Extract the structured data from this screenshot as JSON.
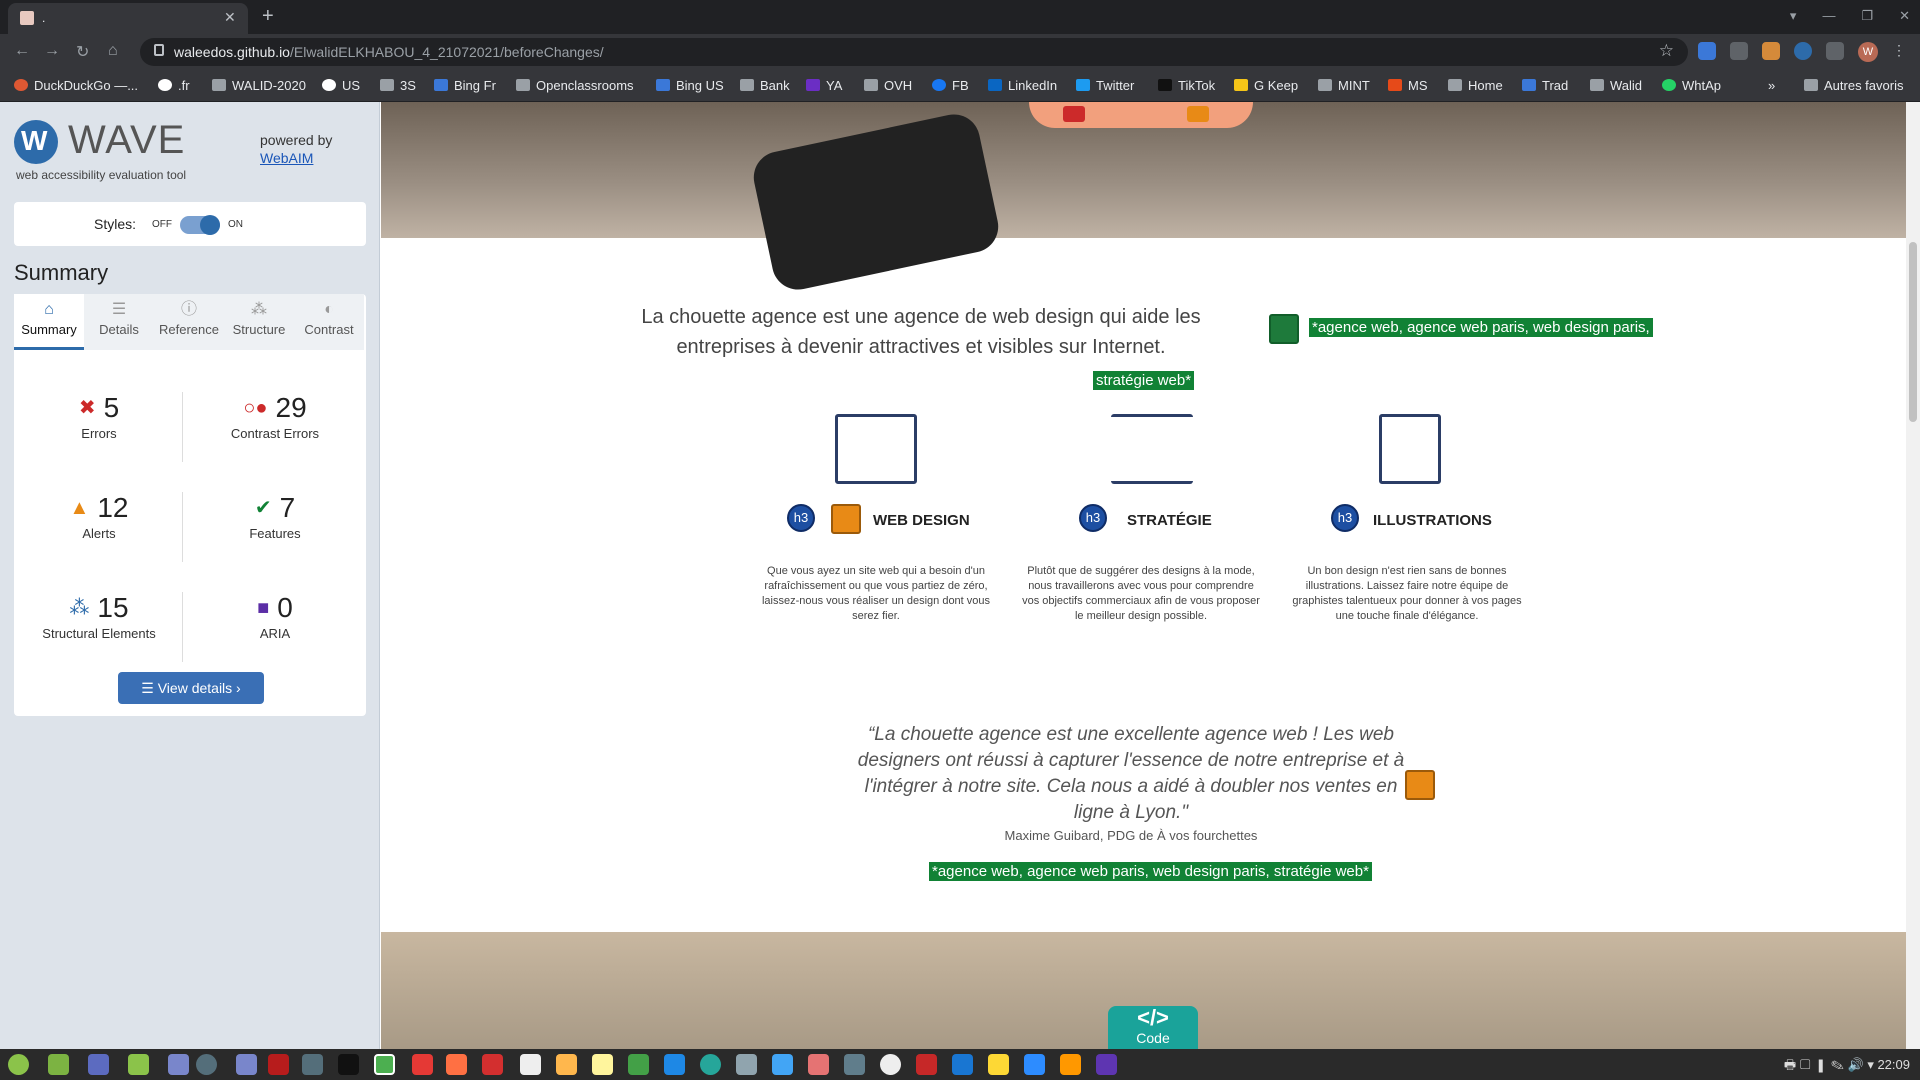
{
  "browser": {
    "tab_title": ".",
    "url_host": "waleedos.github.io",
    "url_path": "/ElwalidELKHABOU_4_21072021/beforeChanges/",
    "avatar_letter": "W",
    "bookmarks": [
      "DuckDuckGo —...",
      ".fr",
      "WALID-2020",
      "US",
      "3S",
      "Bing Fr",
      "Openclassrooms",
      "Bing US",
      "Bank",
      "YA",
      "OVH",
      "FB",
      "LinkedIn",
      "Twitter",
      "TikTok",
      "G Keep",
      "MINT",
      "MS",
      "Home",
      "Trad",
      "Walid",
      "WhtAp",
      "»",
      "Autres favoris"
    ]
  },
  "wave": {
    "name": "WAVE",
    "subtitle": "web accessibility evaluation tool",
    "powered_by": "powered by",
    "webaim": "WebAIM",
    "styles_label": "Styles:",
    "off": "OFF",
    "on": "ON",
    "summary_heading": "Summary",
    "tabs": [
      "Summary",
      "Details",
      "Reference",
      "Structure",
      "Contrast"
    ],
    "stats": {
      "errors": {
        "num": "5",
        "label": "Errors"
      },
      "contrast": {
        "num": "29",
        "label": "Contrast Errors"
      },
      "alerts": {
        "num": "12",
        "label": "Alerts"
      },
      "features": {
        "num": "7",
        "label": "Features"
      },
      "structural": {
        "num": "15",
        "label": "Structural Elements"
      },
      "aria": {
        "num": "0",
        "label": "ARIA"
      }
    },
    "view_details": "View details ›",
    "colors": {
      "brand": "#2d6baa",
      "error": "#cc2a2a",
      "alert": "#e88a16",
      "feature": "#118235"
    }
  },
  "page": {
    "intro": "La chouette agence est une agence de web design qui aide les entreprises à devenir attractives et visibles sur Internet.",
    "alt_1a": "*agence web, agence web paris, web design paris,",
    "alt_1b": "stratégie web*",
    "h3_label": "h3",
    "services": [
      {
        "title": "WEB DESIGN",
        "text": "Que vous ayez un site web qui a besoin d'un rafraîchissement ou que vous partiez de zéro, laissez-nous vous réaliser un design dont vous serez fier."
      },
      {
        "title": "STRATÉGIE",
        "text": "Plutôt que de suggérer des designs à la mode, nous travaillerons avec vous pour comprendre vos objectifs commerciaux afin de vous proposer le meilleur design possible."
      },
      {
        "title": "ILLUSTRATIONS",
        "text": "Un bon design n'est rien sans de bonnes illustrations. Laissez faire notre équipe de graphistes talentueux pour donner à vos pages une touche finale d'élégance."
      }
    ],
    "quote": "“La chouette agence est une excellente agence web ! Les web designers ont réussi à capturer l'essence de notre entreprise et à l'intégrer à notre site. Cela nous a aidé à doubler nos ventes en ligne à Lyon.\"",
    "author": "Maxime Guibard, PDG de À vos fourchettes",
    "alt_2": "*agence web, agence web paris, web design paris, stratégie web*",
    "code_tag": "</>",
    "code_label": "Code"
  },
  "taskbar": {
    "time": "22:09"
  }
}
